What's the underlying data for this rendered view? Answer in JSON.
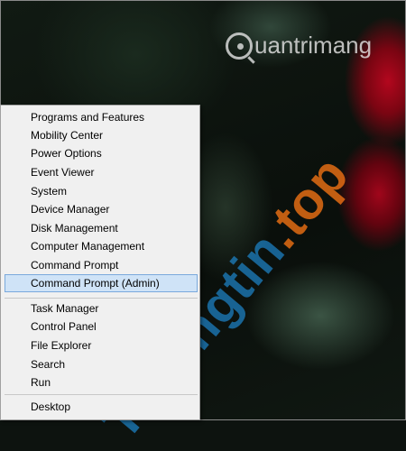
{
  "watermark": {
    "logo_text": "uantrimang",
    "diagonal_main": "Truongtin",
    "diagonal_tld": ".top"
  },
  "context_menu": {
    "groups": [
      {
        "items": [
          {
            "label": "Programs and Features"
          },
          {
            "label": "Mobility Center"
          },
          {
            "label": "Power Options"
          },
          {
            "label": "Event Viewer"
          },
          {
            "label": "System"
          },
          {
            "label": "Device Manager"
          },
          {
            "label": "Disk Management"
          },
          {
            "label": "Computer Management"
          },
          {
            "label": "Command Prompt"
          },
          {
            "label": "Command Prompt (Admin)",
            "highlighted": true
          }
        ]
      },
      {
        "items": [
          {
            "label": "Task Manager"
          },
          {
            "label": "Control Panel"
          },
          {
            "label": "File Explorer"
          },
          {
            "label": "Search"
          },
          {
            "label": "Run"
          }
        ]
      },
      {
        "items": [
          {
            "label": "Desktop"
          }
        ]
      }
    ]
  },
  "colors": {
    "menu_background": "#f0f0f0",
    "highlight_background": "#cfe3f7",
    "highlight_border": "#7aa9dc"
  }
}
